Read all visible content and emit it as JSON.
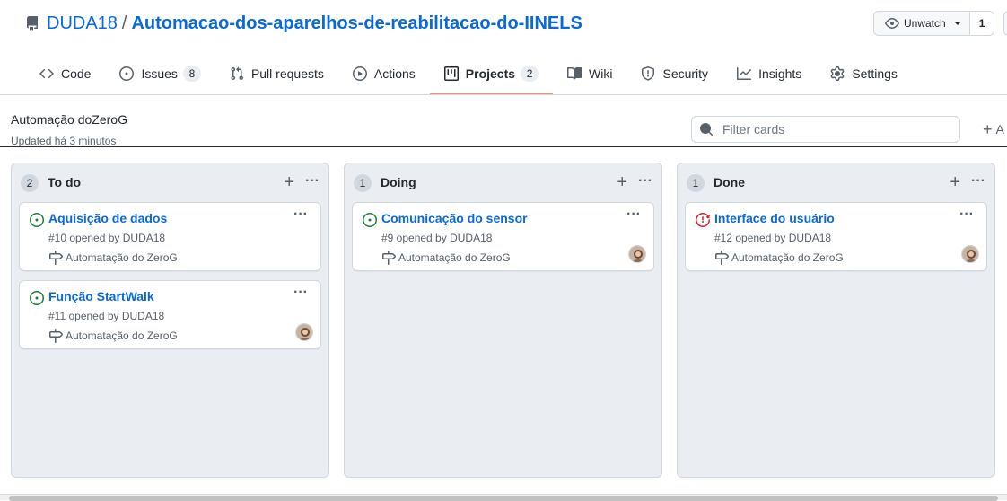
{
  "repo": {
    "owner": "DUDA18",
    "separator": "/",
    "name": "Automacao-dos-aparelhos-de-reabilitacao-do-IINELS",
    "watch_label": "Unwatch",
    "watch_count": "1"
  },
  "tabs": [
    {
      "label": "Code",
      "icon": "code-icon"
    },
    {
      "label": "Issues",
      "icon": "issue-icon",
      "count": "8"
    },
    {
      "label": "Pull requests",
      "icon": "pull-request-icon"
    },
    {
      "label": "Actions",
      "icon": "play-icon"
    },
    {
      "label": "Projects",
      "icon": "project-icon",
      "count": "2",
      "selected": true
    },
    {
      "label": "Wiki",
      "icon": "book-icon"
    },
    {
      "label": "Security",
      "icon": "shield-icon"
    },
    {
      "label": "Insights",
      "icon": "graph-icon"
    },
    {
      "label": "Settings",
      "icon": "gear-icon"
    }
  ],
  "project": {
    "title": "Automação doZeroG",
    "updated": "Updated há 3 minutos",
    "filter_placeholder": "Filter cards",
    "add_cards_label": "A"
  },
  "columns": [
    {
      "count": "2",
      "name": "To do",
      "cards": [
        {
          "title": "Aquisição de dados",
          "meta": "#10 opened by DUDA18",
          "project": "Automatação do ZeroG",
          "status": "open",
          "avatar": false
        },
        {
          "title": "Função StartWalk",
          "meta": "#11 opened by DUDA18",
          "project": "Automatação do ZeroG",
          "status": "open",
          "avatar": true
        }
      ]
    },
    {
      "count": "1",
      "name": "Doing",
      "cards": [
        {
          "title": "Comunicação do sensor",
          "meta": "#9 opened by DUDA18",
          "project": "Automatação do ZeroG",
          "status": "open",
          "avatar": true
        }
      ]
    },
    {
      "count": "1",
      "name": "Done",
      "cards": [
        {
          "title": "Interface do usuário",
          "meta": "#12 opened by DUDA18",
          "project": "Automatação do ZeroG",
          "status": "closed",
          "avatar": true
        }
      ]
    }
  ],
  "icons": {
    "col_add": "+",
    "more": "···"
  },
  "colors": {
    "link": "#0969da",
    "open_issue": "#1a7f37",
    "closed_issue": "#cf222e",
    "selected_tab_underline": "#fd8c73",
    "column_bg": "#eaeef2"
  }
}
